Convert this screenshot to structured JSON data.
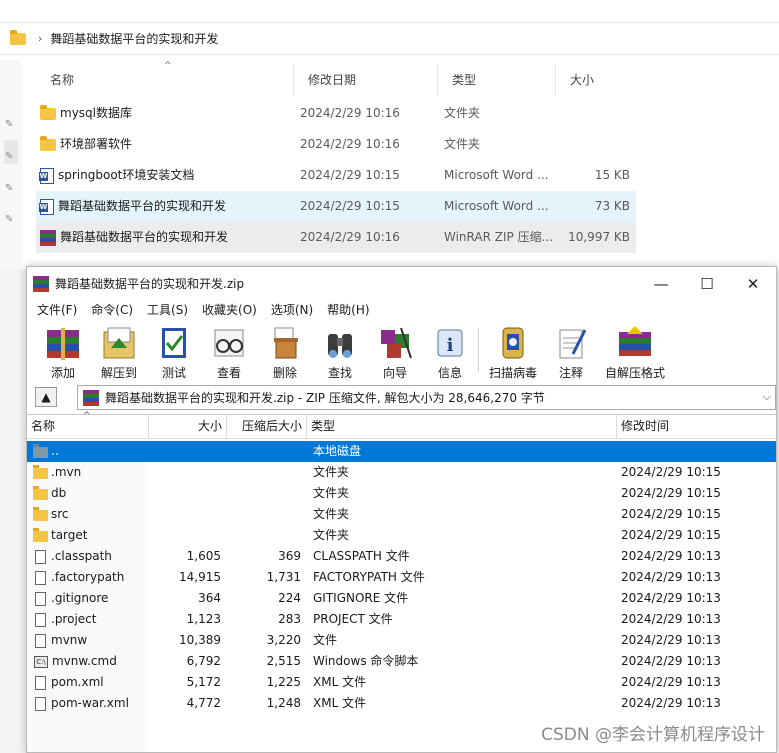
{
  "explorer": {
    "breadcrumb": "舞蹈基础数据平台的实现和开发",
    "columns": [
      "名称",
      "修改日期",
      "类型",
      "大小"
    ],
    "rows": [
      {
        "name": "mysql数据库",
        "date": "2024/2/29 10:16",
        "type": "文件夹",
        "size": "",
        "icon": "folder-icon"
      },
      {
        "name": "环境部署软件",
        "date": "2024/2/29 10:16",
        "type": "文件夹",
        "size": "",
        "icon": "folder-icon"
      },
      {
        "name": "springboot环境安装文档",
        "date": "2024/2/29 10:15",
        "type": "Microsoft Word ...",
        "size": "15 KB",
        "icon": "word-icon"
      },
      {
        "name": "舞蹈基础数据平台的实现和开发",
        "date": "2024/2/29 10:15",
        "type": "Microsoft Word ...",
        "size": "73 KB",
        "icon": "word-icon"
      },
      {
        "name": "舞蹈基础数据平台的实现和开发",
        "date": "2024/2/29 10:16",
        "type": "WinRAR ZIP 压缩...",
        "size": "10,997 KB",
        "icon": "rar-icon"
      }
    ]
  },
  "winrar": {
    "title": "舞蹈基础数据平台的实现和开发.zip",
    "window_buttons": {
      "minimize": "—",
      "maximize": "☐",
      "close": "✕"
    },
    "menu": [
      "文件(F)",
      "命令(C)",
      "工具(S)",
      "收藏夹(O)",
      "选项(N)",
      "帮助(H)"
    ],
    "toolbar": [
      "添加",
      "解压到",
      "测试",
      "查看",
      "删除",
      "查找",
      "向导",
      "信息",
      "扫描病毒",
      "注释",
      "自解压格式"
    ],
    "path_text": "舞蹈基础数据平台的实现和开发.zip - ZIP 压缩文件, 解包大小为 28,646,270 字节",
    "columns": [
      "名称",
      "大小",
      "压缩后大小",
      "类型",
      "修改时间"
    ],
    "rows": [
      {
        "name": "..",
        "size": "",
        "packed": "",
        "type": "本地磁盘",
        "date": "",
        "kind": "up"
      },
      {
        "name": ".mvn",
        "size": "",
        "packed": "",
        "type": "文件夹",
        "date": "2024/2/29 10:15",
        "kind": "folder"
      },
      {
        "name": "db",
        "size": "",
        "packed": "",
        "type": "文件夹",
        "date": "2024/2/29 10:15",
        "kind": "folder"
      },
      {
        "name": "src",
        "size": "",
        "packed": "",
        "type": "文件夹",
        "date": "2024/2/29 10:15",
        "kind": "folder"
      },
      {
        "name": "target",
        "size": "",
        "packed": "",
        "type": "文件夹",
        "date": "2024/2/29 10:15",
        "kind": "folder"
      },
      {
        "name": ".classpath",
        "size": "1,605",
        "packed": "369",
        "type": "CLASSPATH 文件",
        "date": "2024/2/29 10:13",
        "kind": "file"
      },
      {
        "name": ".factorypath",
        "size": "14,915",
        "packed": "1,731",
        "type": "FACTORYPATH 文件",
        "date": "2024/2/29 10:13",
        "kind": "file"
      },
      {
        "name": ".gitignore",
        "size": "364",
        "packed": "224",
        "type": "GITIGNORE 文件",
        "date": "2024/2/29 10:13",
        "kind": "file"
      },
      {
        "name": ".project",
        "size": "1,123",
        "packed": "283",
        "type": "PROJECT 文件",
        "date": "2024/2/29 10:13",
        "kind": "file"
      },
      {
        "name": "mvnw",
        "size": "10,389",
        "packed": "3,220",
        "type": "文件",
        "date": "2024/2/29 10:13",
        "kind": "file"
      },
      {
        "name": "mvnw.cmd",
        "size": "6,792",
        "packed": "2,515",
        "type": "Windows 命令脚本",
        "date": "2024/2/29 10:13",
        "kind": "cmd"
      },
      {
        "name": "pom.xml",
        "size": "5,172",
        "packed": "1,225",
        "type": "XML 文件",
        "date": "2024/2/29 10:13",
        "kind": "file"
      },
      {
        "name": "pom-war.xml",
        "size": "4,772",
        "packed": "1,248",
        "type": "XML 文件",
        "date": "2024/2/29 10:13",
        "kind": "file"
      }
    ]
  },
  "watermark": "CSDN @李会计算机程序设计",
  "colors": {
    "selection": "#0078d7",
    "explorer_selected": "#e5f3fb"
  }
}
